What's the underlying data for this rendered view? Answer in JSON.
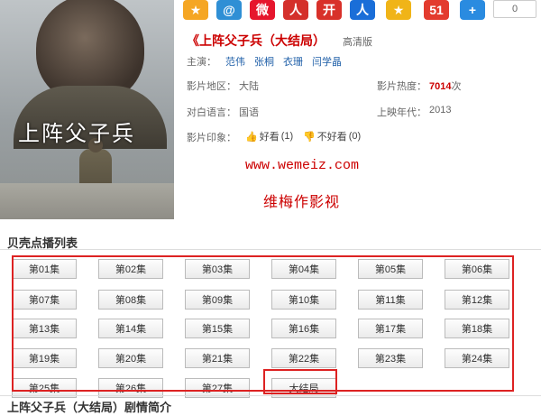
{
  "poster": {
    "title_art": "上阵父子兵"
  },
  "share": {
    "icons": [
      {
        "name": "qzone-star-icon",
        "glyph": "★",
        "color": "#f5a623"
      },
      {
        "name": "weibo-tencent-icon",
        "glyph": "@",
        "color": "#2f8fd5"
      },
      {
        "name": "sina-weibo-icon",
        "glyph": "微",
        "color": "#e6162d"
      },
      {
        "name": "renren-icon",
        "glyph": "人",
        "color": "#d4302b"
      },
      {
        "name": "kaixin-icon",
        "glyph": "开",
        "color": "#d8312a"
      },
      {
        "name": "renren-blue-icon",
        "glyph": "人",
        "color": "#1a6ed8"
      },
      {
        "name": "pengyou-star-icon",
        "glyph": "★",
        "color": "#f0b418"
      },
      {
        "name": "51-icon",
        "glyph": "51",
        "color": "#e33b2e"
      },
      {
        "name": "more-plus-icon",
        "glyph": "+",
        "color": "#2a8be0"
      }
    ],
    "count": "0"
  },
  "movie": {
    "title": "《上阵父子兵（大结局）",
    "quality": "高清版",
    "cast_label": "主演：",
    "cast": [
      "范伟",
      "张桐",
      "衣珊",
      "闫学晶"
    ],
    "region_label": "影片地区：",
    "region": "大陆",
    "heat_label": "影片热度：",
    "heat_value": "7014",
    "heat_unit": "次",
    "language_label": "对白语言：",
    "language": "国语",
    "year_label": "上映年代：",
    "year": "2013",
    "impression_label": "影片印象：",
    "good_label": "好看",
    "good_count": "(1)",
    "bad_label": "不好看",
    "bad_count": "(0)"
  },
  "watermark": {
    "url": "www.wemeiz.com",
    "name": "维梅作影视"
  },
  "playlist": {
    "heading": "贝壳点播列表",
    "episodes": [
      "第01集",
      "第02集",
      "第03集",
      "第04集",
      "第05集",
      "第06集",
      "第07集",
      "第08集",
      "第09集",
      "第10集",
      "第11集",
      "第12集",
      "第13集",
      "第14集",
      "第15集",
      "第16集",
      "第17集",
      "第18集",
      "第19集",
      "第20集",
      "第21集",
      "第22集",
      "第23集",
      "第24集",
      "第25集",
      "第26集",
      "第27集",
      "大结局"
    ]
  },
  "synopsis": {
    "heading": "上阵父子兵（大结局）剧情简介"
  }
}
